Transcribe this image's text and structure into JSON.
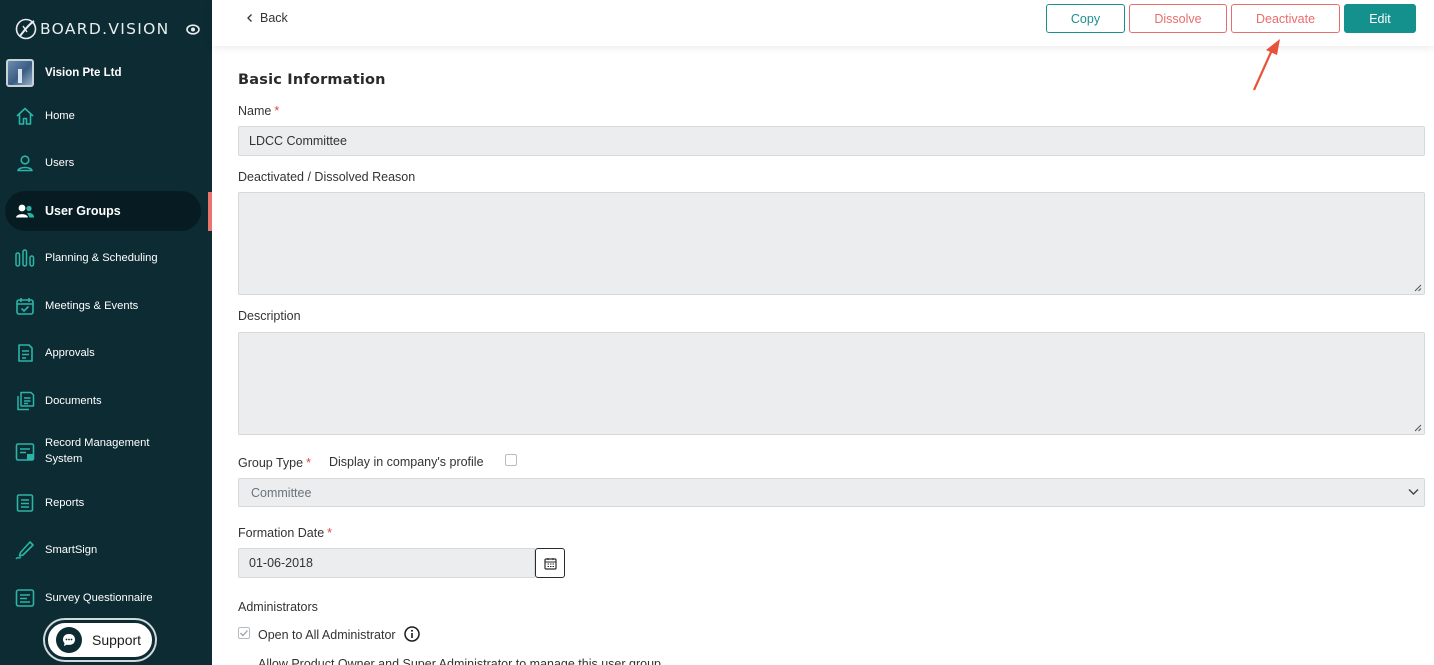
{
  "brand": {
    "name": "BOARD.VISION"
  },
  "org": {
    "name": "Vision Pte Ltd"
  },
  "nav": {
    "items": [
      {
        "label": "Home",
        "icon": "home-icon"
      },
      {
        "label": "Users",
        "icon": "user-icon"
      },
      {
        "label": "User Groups",
        "icon": "users-group-icon",
        "active": true
      },
      {
        "label": "Planning & Scheduling",
        "icon": "bar-chart-icon"
      },
      {
        "label": "Meetings & Events",
        "icon": "calendar-check-icon"
      },
      {
        "label": "Approvals",
        "icon": "approval-doc-icon"
      },
      {
        "label": "Documents",
        "icon": "documents-icon"
      },
      {
        "label": "Record Management",
        "label2": "System",
        "icon": "record-box-icon"
      },
      {
        "label": "Reports",
        "icon": "report-icon"
      },
      {
        "label": "SmartSign",
        "icon": "pen-sign-icon"
      },
      {
        "label": "Survey Questionnaire",
        "icon": "survey-icon"
      }
    ]
  },
  "support": {
    "label": "Support"
  },
  "toolbar": {
    "back_label": "Back",
    "copy_label": "Copy",
    "dissolve_label": "Dissolve",
    "deactivate_label": "Deactivate",
    "edit_label": "Edit"
  },
  "form": {
    "section_title": "Basic Information",
    "name_label": "Name",
    "name_value": "LDCC Committee",
    "reason_label": "Deactivated / Dissolved Reason",
    "reason_value": "",
    "description_label": "Description",
    "description_value": "",
    "group_type_label": "Group Type",
    "display_profile_label": "Display in company's profile",
    "group_type_value": "Committee",
    "formation_date_label": "Formation Date",
    "formation_date_value": "01-06-2018",
    "administrators_label": "Administrators",
    "open_admin_label": "Open to All Administrator",
    "allow_label": "Allow Product Owner and Super Administrator to manage this user group"
  },
  "colors": {
    "sidebar_bg": "#0d2b33",
    "accent_teal": "#14918d",
    "danger": "#ea6d6d",
    "annotation_arrow": "#e8513b"
  }
}
